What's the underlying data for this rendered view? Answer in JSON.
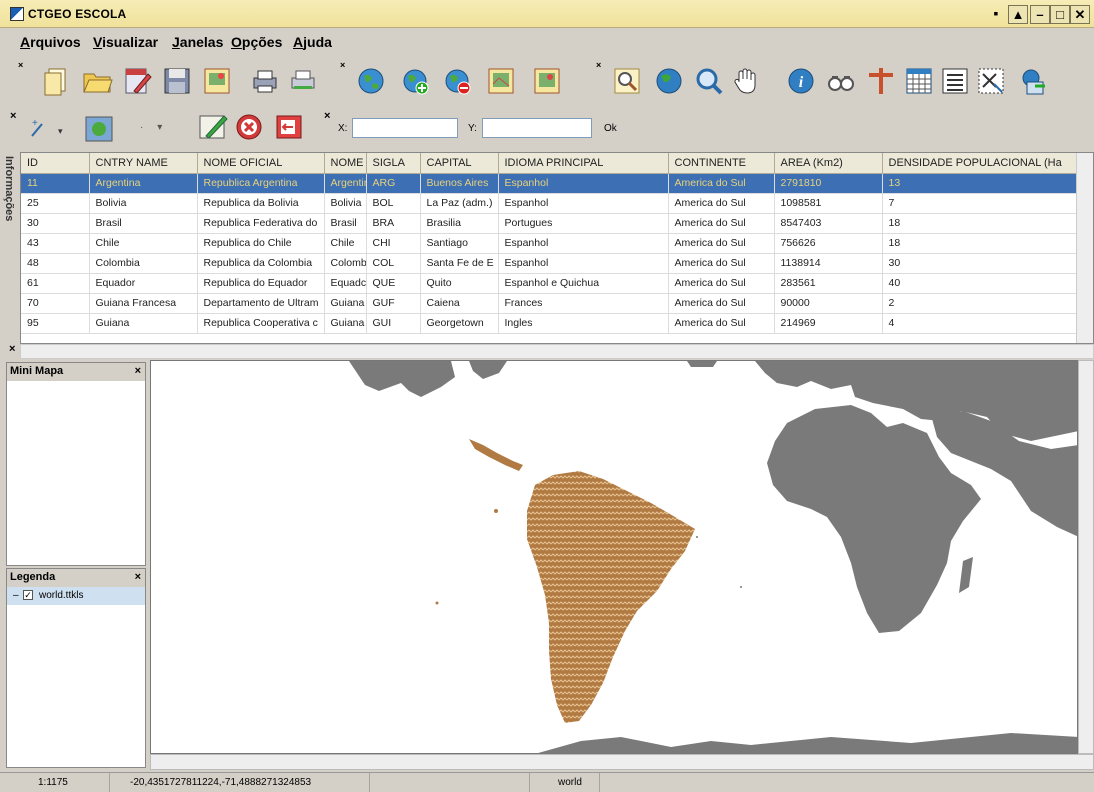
{
  "window": {
    "title": "CTGEO ESCOLA"
  },
  "menu": [
    {
      "label": "Arquivos",
      "accel": "A",
      "rest": "rquivos"
    },
    {
      "label": "Visualizar",
      "accel": "V",
      "rest": "isualizar"
    },
    {
      "label": "Janelas",
      "accel": "J",
      "rest": "anelas"
    },
    {
      "label": "Opções",
      "accel": "O",
      "rest": "pções"
    },
    {
      "label": "Ajuda",
      "accel": "A",
      "rest": "juda"
    }
  ],
  "toolbar": {
    "x_label": "X:",
    "y_label": "Y:",
    "x_value": "",
    "y_value": "",
    "ok_label": "Ok"
  },
  "side_tab": {
    "label": "Informações"
  },
  "grid": {
    "columns": [
      "ID",
      "CNTRY NAME",
      "NOME OFICIAL",
      "NOME",
      "SIGLA",
      "CAPITAL",
      "IDIOMA PRINCIPAL",
      "CONTINENTE",
      "AREA (Km2)",
      "DENSIDADE POPULACIONAL (Ha"
    ],
    "rows": [
      [
        "11",
        "Argentina",
        "Republica Argentina",
        "Argentir",
        "ARG",
        "Buenos Aires",
        "Espanhol",
        "America do Sul",
        "2791810",
        "13"
      ],
      [
        "25",
        "Bolivia",
        "Republica da Bolivia",
        "Bolivia",
        "BOL",
        "La Paz (adm.)",
        "Espanhol",
        "America do Sul",
        "1098581",
        "7"
      ],
      [
        "30",
        "Brasil",
        "Republica Federativa do",
        "Brasil",
        "BRA",
        "Brasilia",
        "Portugues",
        "America do Sul",
        "8547403",
        "18"
      ],
      [
        "43",
        "Chile",
        "Republica do Chile",
        "Chile",
        "CHI",
        "Santiago",
        "Espanhol",
        "America do Sul",
        "756626",
        "18"
      ],
      [
        "48",
        "Colombia",
        "Republica da Colombia",
        "Colomb",
        "COL",
        "Santa Fe de E",
        "Espanhol",
        "America do Sul",
        "1138914",
        "30"
      ],
      [
        "61",
        "Equador",
        "Republica do Equador",
        "Equadc",
        "QUE",
        "Quito",
        "Espanhol e Quichua",
        "America do Sul",
        "283561",
        "40"
      ],
      [
        "70",
        "Guiana Francesa",
        "Departamento de Ultram",
        "Guiana",
        "GUF",
        "Caiena",
        "Frances",
        "America do Sul",
        "90000",
        "2"
      ],
      [
        "95",
        "Guiana",
        "Republica Cooperativa c",
        "Guiana",
        "GUI",
        "Georgetown",
        "Ingles",
        "America do Sul",
        "214969",
        "4"
      ]
    ],
    "selected_row": 0
  },
  "panels": {
    "minimap_title": "Mini Mapa",
    "legend_title": "Legenda",
    "legend_layer": "world.ttkls",
    "legend_checked": true
  },
  "status": {
    "scale": "1:1175",
    "coords": "-20,4351727811224,-71,4888271324853",
    "layer": "world"
  },
  "colors": {
    "title_bar": "#f0e29a",
    "selection": "#3d6fb4",
    "land": "#7a7a7a",
    "highlight": "#a8723a"
  },
  "icons": {
    "toolbar1": [
      "new-document-icon",
      "open-folder-icon",
      "edit-document-icon",
      "save-icon",
      "image-icon",
      "print-icon",
      "print-preview-icon",
      "globe-icon",
      "add-layer-icon",
      "remove-layer-icon",
      "map-image-icon",
      "map-image-2-icon",
      "zoom-rect-icon",
      "full-extent-icon",
      "zoom-icon",
      "pan-hand-icon",
      "info-icon",
      "binoculars-icon",
      "measure-icon",
      "table-icon",
      "list-icon",
      "select-icon",
      "export-icon"
    ]
  }
}
